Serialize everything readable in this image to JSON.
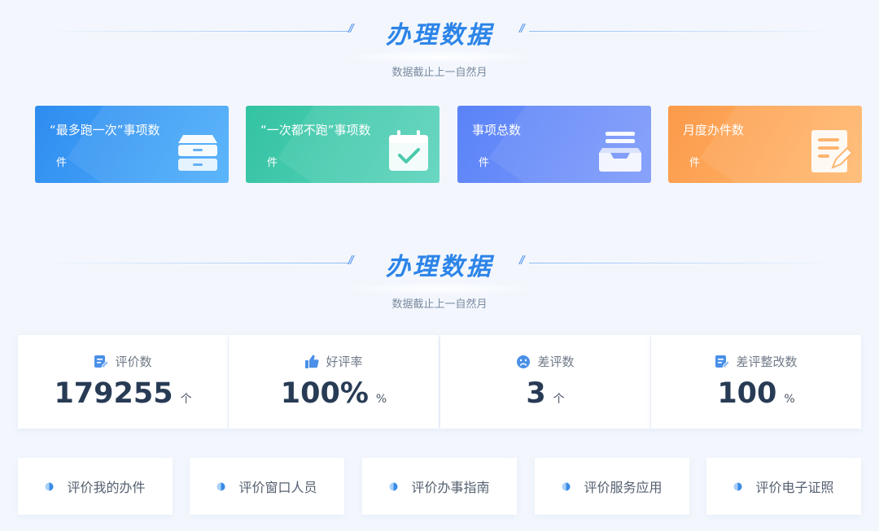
{
  "section1": {
    "title": "办理数据",
    "subtitle": "数据截止上一自然月"
  },
  "cards": [
    {
      "label": "“最多跑一次”事项数",
      "unit": "件",
      "icon": "cabinet-icon",
      "color": "#2f8cf0"
    },
    {
      "label": "“一次都不跑”事项数",
      "unit": "件",
      "icon": "calendar-check-icon",
      "color": "#33c3a2"
    },
    {
      "label": "事项总数",
      "unit": "件",
      "icon": "inbox-tray-icon",
      "color": "#5a83f8"
    },
    {
      "label": "月度办件数",
      "unit": "件",
      "icon": "document-edit-icon",
      "color": "#fc9a4a"
    }
  ],
  "section2": {
    "title": "办理数据",
    "subtitle": "数据截止上一自然月"
  },
  "stats": [
    {
      "label": "评价数",
      "value": "179255",
      "unit": "个",
      "icon": "note-edit-icon"
    },
    {
      "label": "好评率",
      "value": "100%",
      "unit": "%",
      "icon": "thumbs-up-icon"
    },
    {
      "label": "差评数",
      "value": "3",
      "unit": "个",
      "icon": "sad-face-icon"
    },
    {
      "label": "差评整改数",
      "value": "100",
      "unit": "%",
      "icon": "note-edit-icon"
    }
  ],
  "links": [
    {
      "label": "评价我的办件"
    },
    {
      "label": "评价窗口人员"
    },
    {
      "label": "评价办事指南"
    },
    {
      "label": "评价服务应用"
    },
    {
      "label": "评价电子证照"
    }
  ],
  "colors": {
    "title": "#2c84e8",
    "number": "#283b55",
    "background": "#f3f7fd"
  }
}
